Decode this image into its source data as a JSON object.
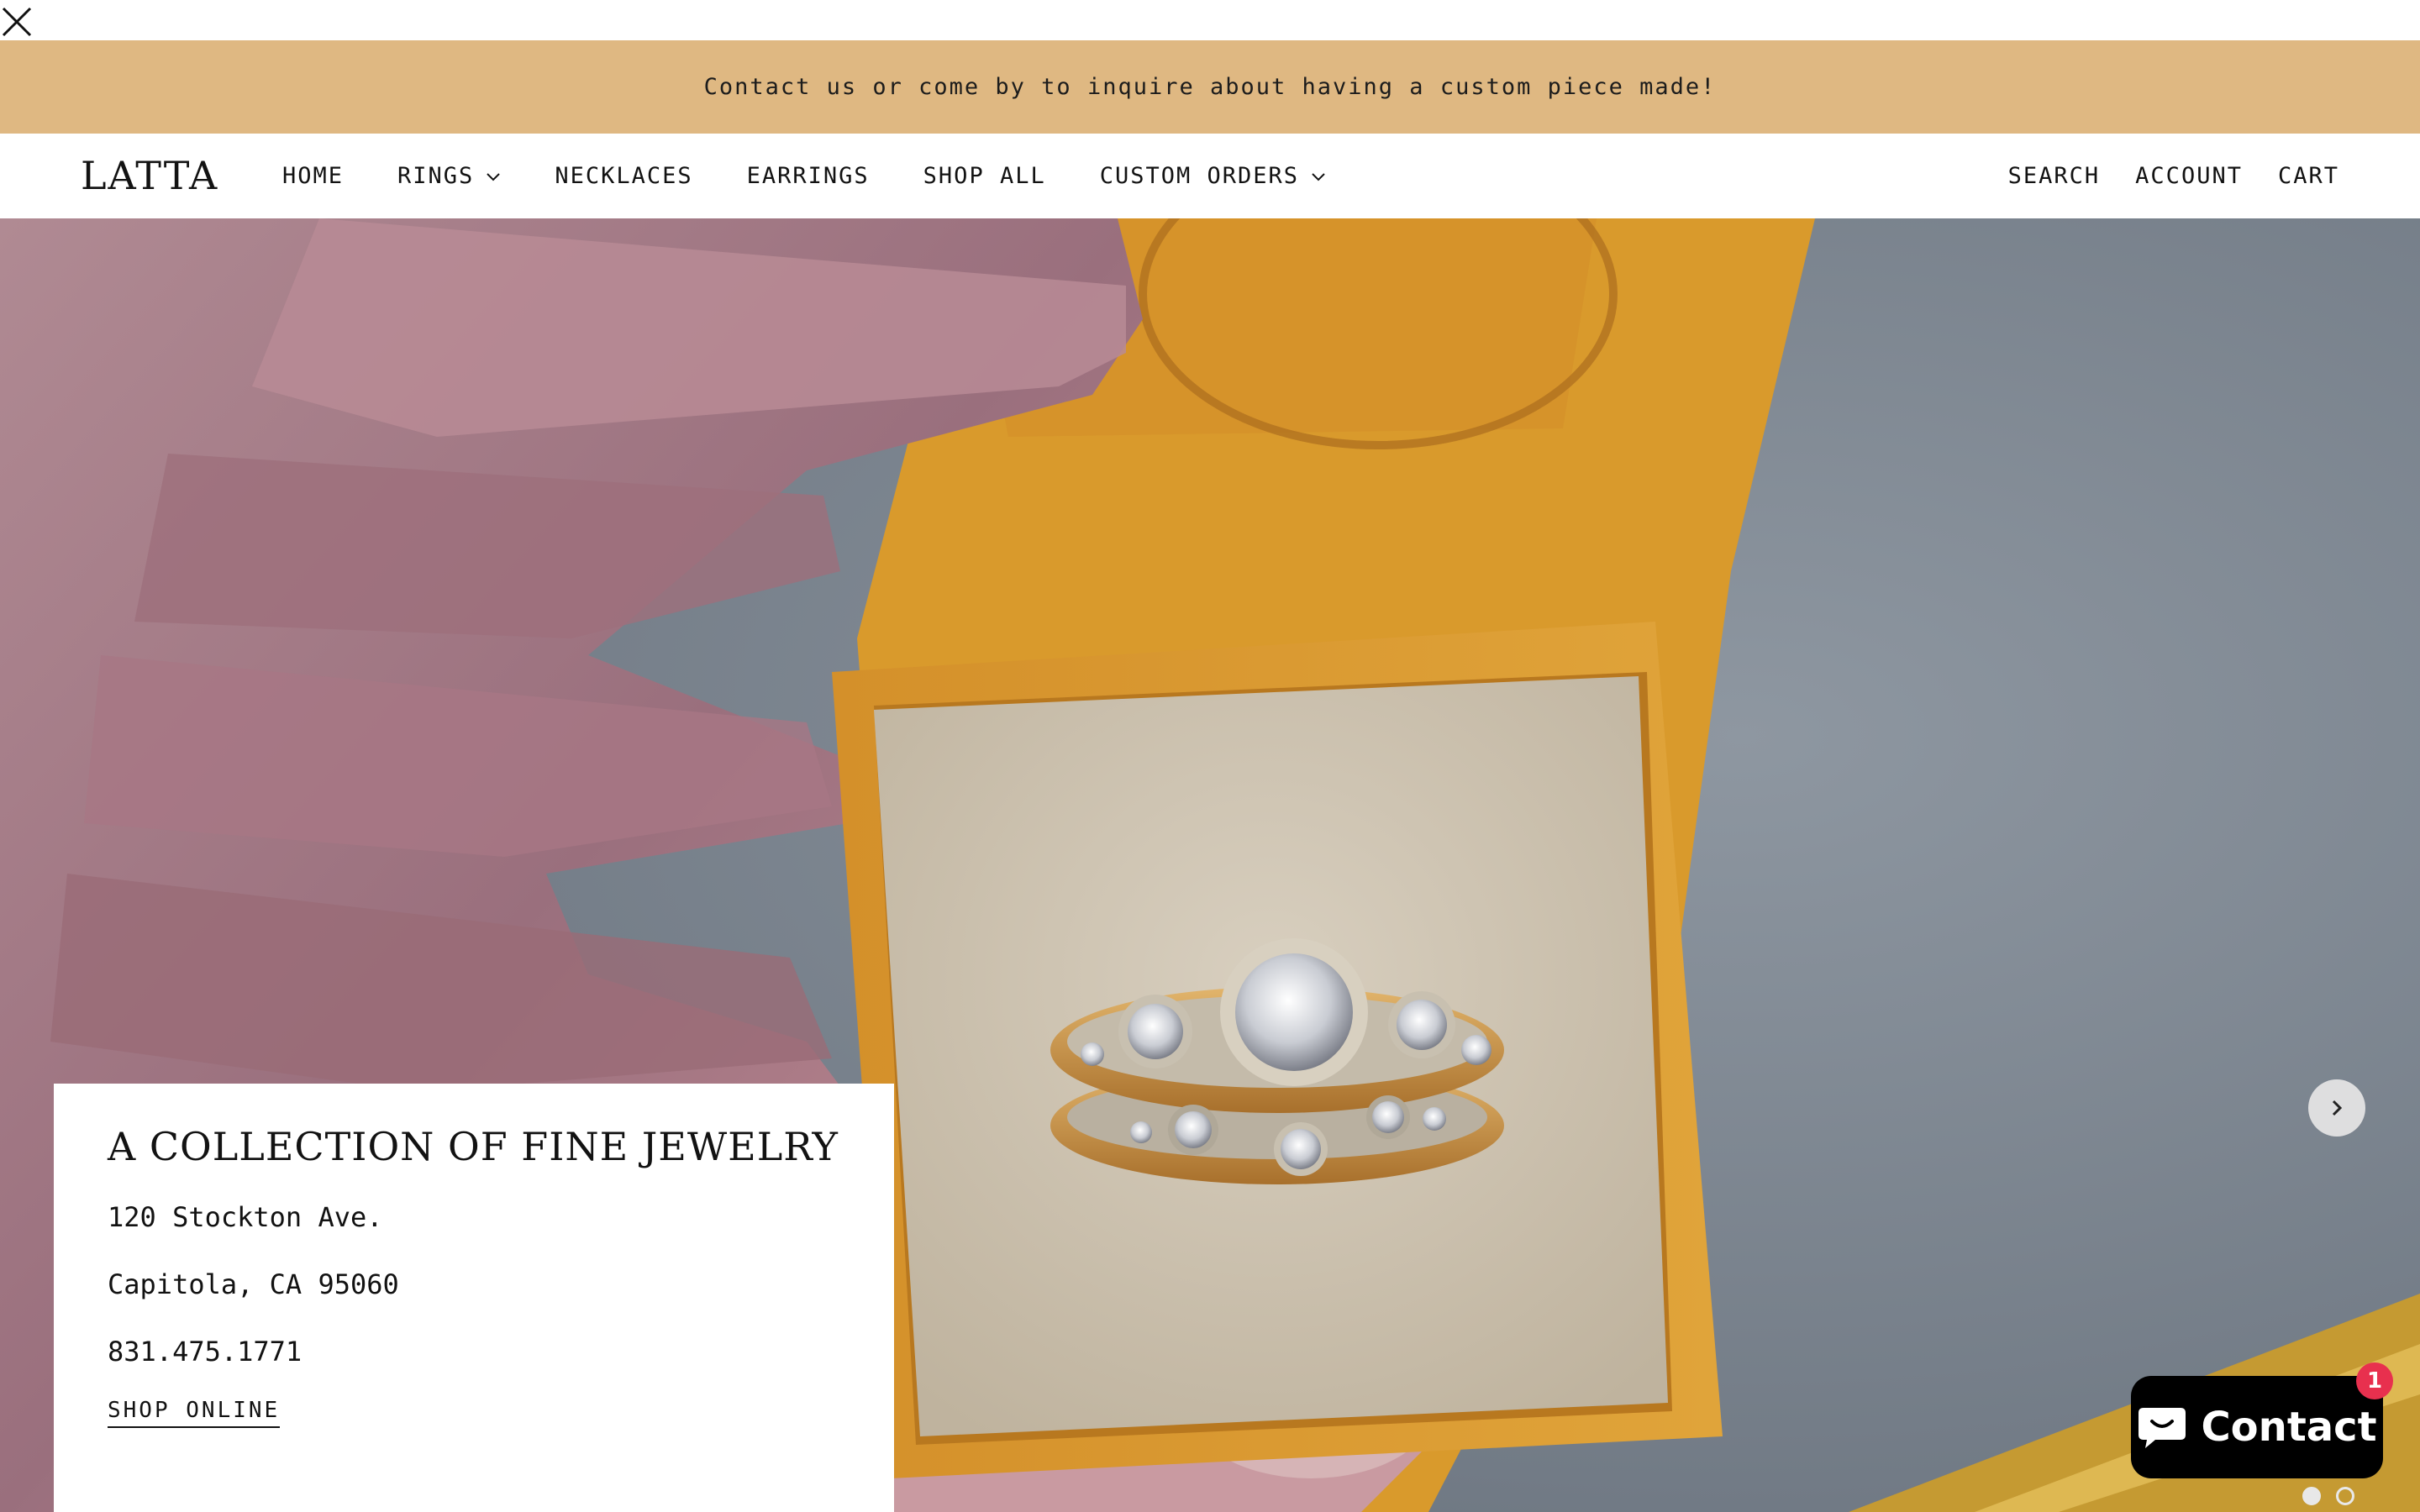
{
  "close": {
    "icon": "close-icon"
  },
  "announcement": {
    "text": "Contact us or come by to inquire about having a custom piece made!",
    "background": "#dfb882"
  },
  "header": {
    "logo": "LATTA",
    "nav": [
      {
        "label": "HOME",
        "has_dropdown": false
      },
      {
        "label": "RINGS",
        "has_dropdown": true
      },
      {
        "label": "NECKLACES",
        "has_dropdown": false
      },
      {
        "label": "EARRINGS",
        "has_dropdown": false
      },
      {
        "label": "SHOP ALL",
        "has_dropdown": false
      },
      {
        "label": "CUSTOM ORDERS",
        "has_dropdown": true
      }
    ],
    "utilities": [
      "SEARCH",
      "ACCOUNT",
      "CART"
    ]
  },
  "hero": {
    "image": "ring-in-gift-box-photo",
    "next_icon": "chevron-right-icon",
    "slides_total": 2,
    "active_slide": 1
  },
  "card": {
    "title": "A COLLECTION OF FINE JEWELRY",
    "address_line_1": "120 Stockton Ave.",
    "address_line_2": "Capitola, CA 95060",
    "phone": "831.475.1771",
    "link_label": "SHOP ONLINE"
  },
  "chat": {
    "label": "Contact",
    "badge_count": "1",
    "icon": "chat-bubble-icon",
    "badge_color": "#e8304e"
  }
}
